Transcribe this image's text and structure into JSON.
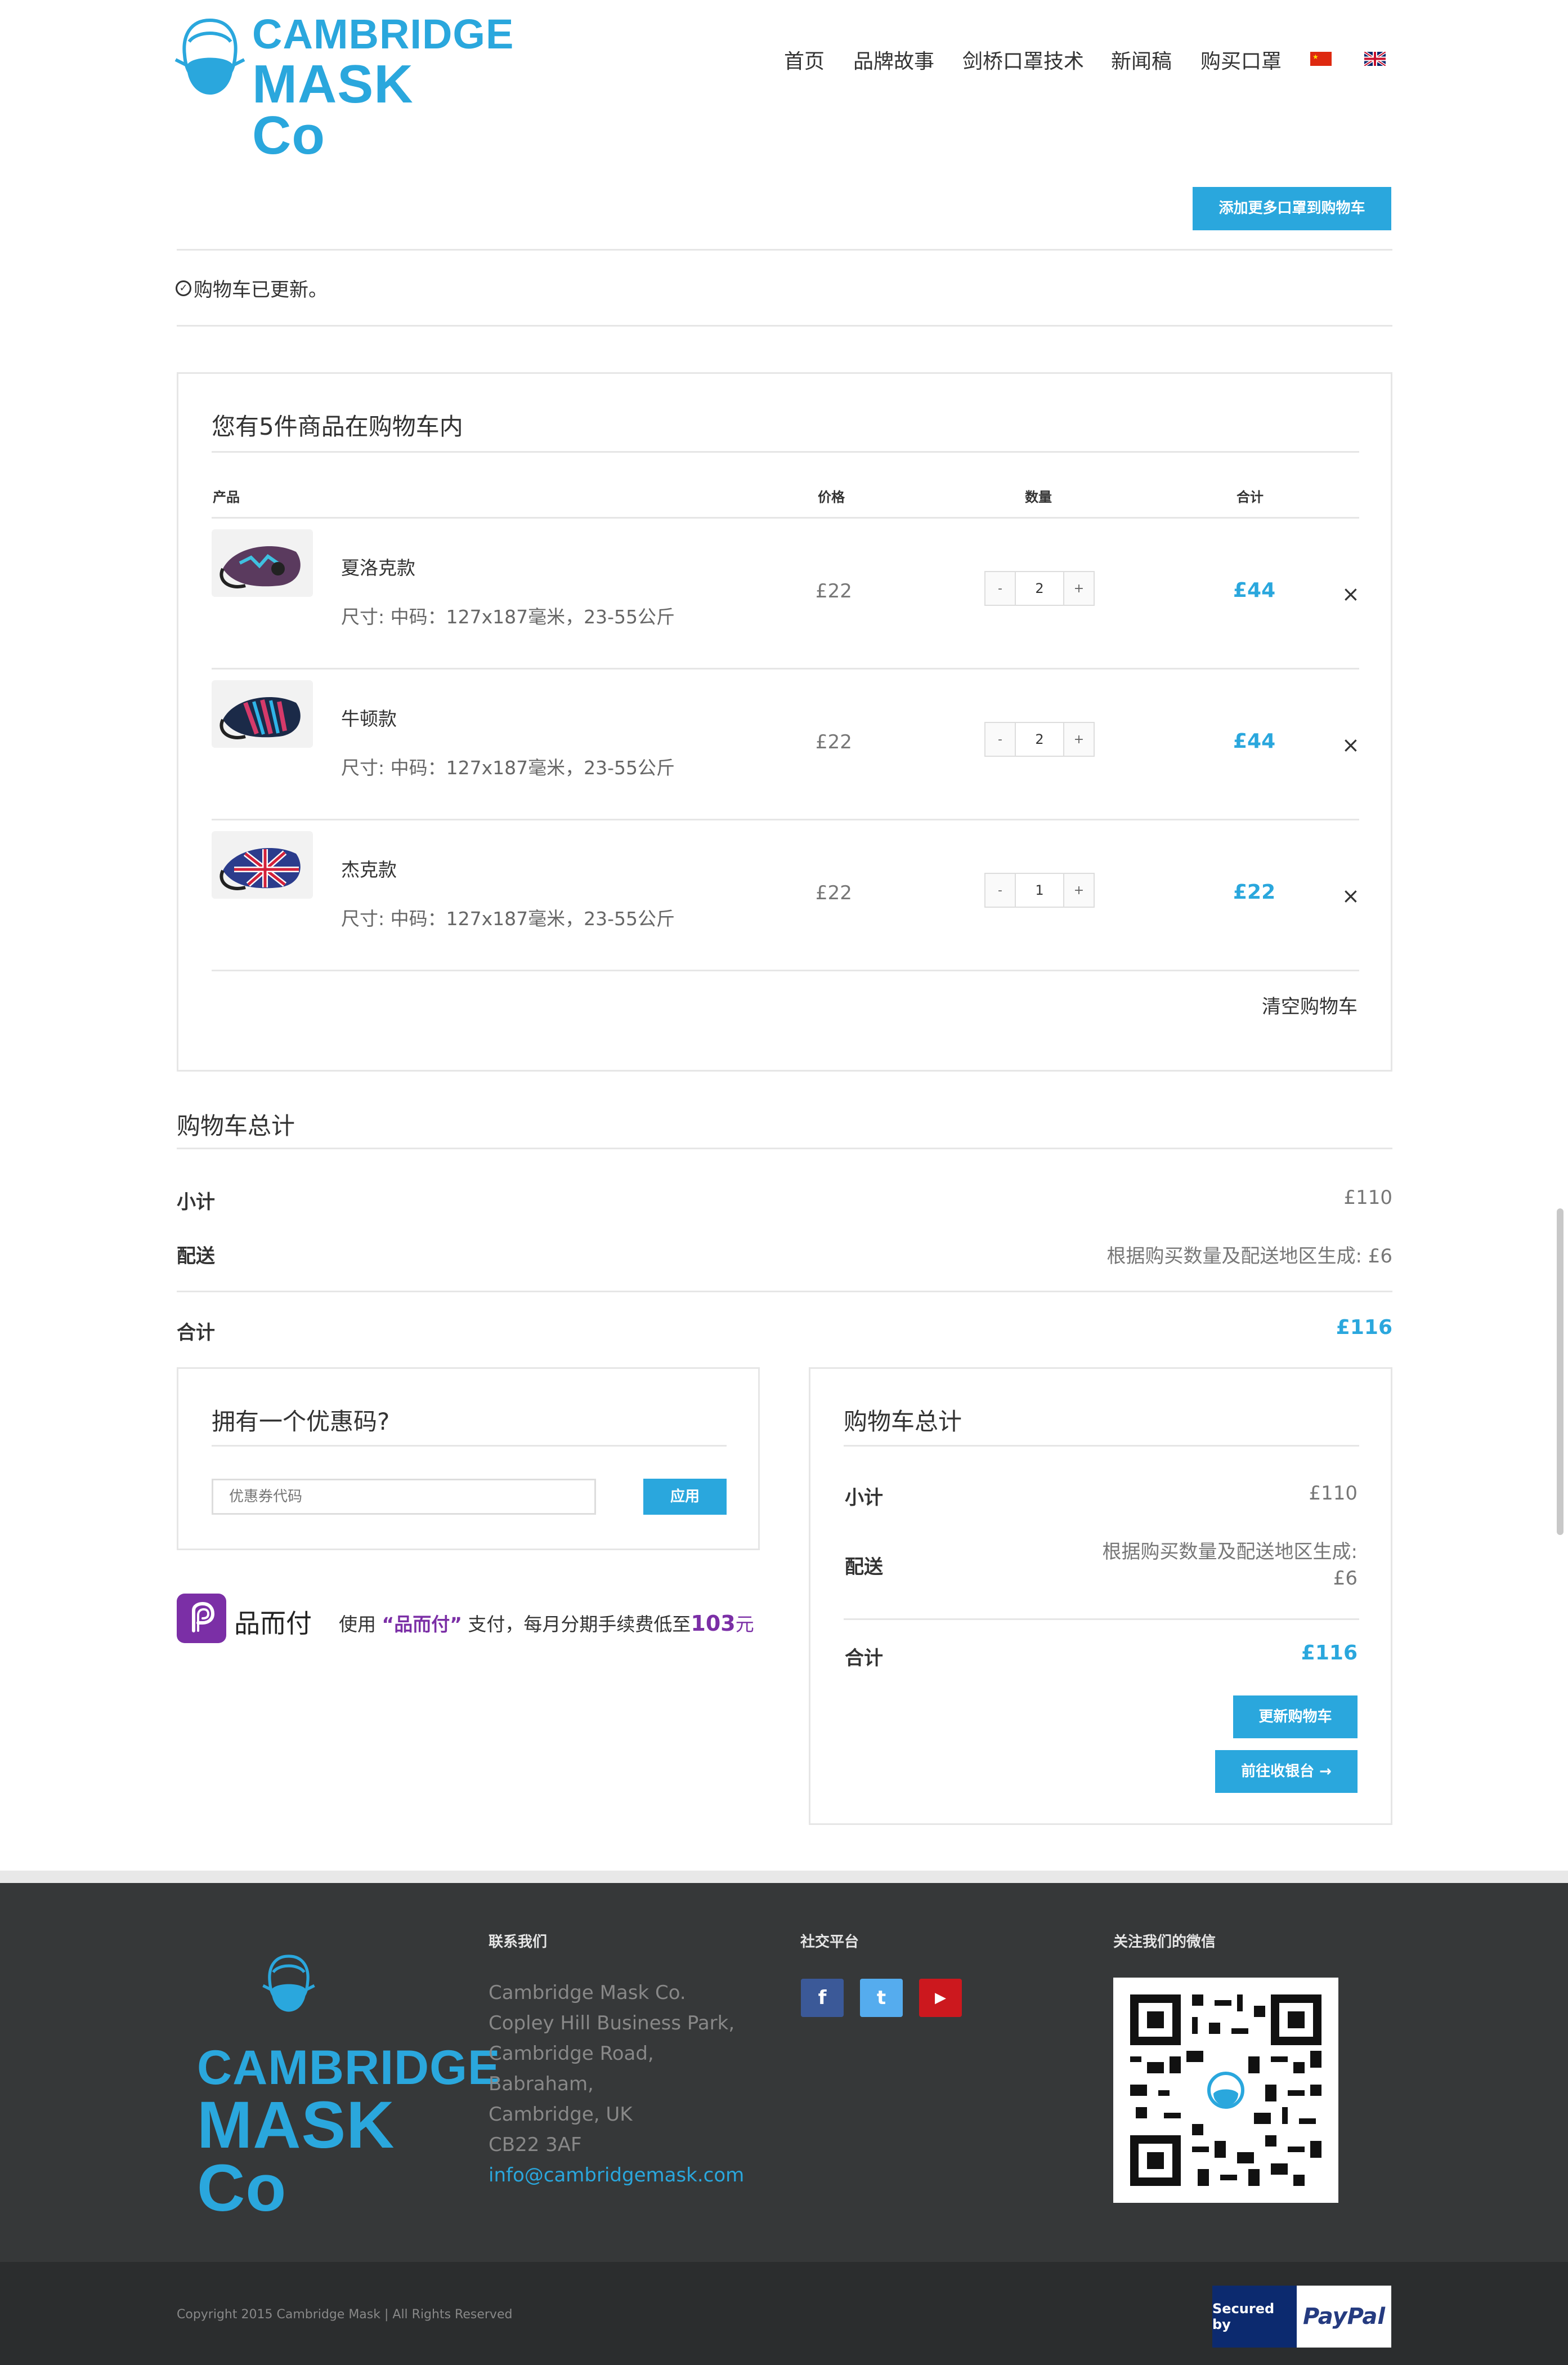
{
  "header": {
    "logo_line1": "CAMBRIDGE",
    "logo_line2": "MASK Co",
    "nav": [
      "首页",
      "品牌故事",
      "剑桥口罩技术",
      "新闻稿",
      "购买口罩"
    ],
    "lang_icons": [
      "china-flag-icon",
      "uk-flag-icon"
    ]
  },
  "cart_actions": {
    "add_more_button": "添加更多口罩到购物车",
    "updated_notice": "购物车已更新。"
  },
  "cart": {
    "heading": "您有5件商品在购物车内",
    "columns": [
      "产品",
      "价格",
      "数量",
      "合计"
    ],
    "items": [
      {
        "name": "夏洛克款",
        "meta": "尺寸: 中码：127x187毫米，23-55公斤",
        "price": "£22",
        "qty": "2",
        "total": "£44"
      },
      {
        "name": "牛顿款",
        "meta": "尺寸: 中码：127x187毫米，23-55公斤",
        "price": "£22",
        "qty": "2",
        "total": "£44"
      },
      {
        "name": "杰克款",
        "meta": "尺寸: 中码：127x187毫米，23-55公斤",
        "price": "£22",
        "qty": "1",
        "total": "£22"
      }
    ],
    "qty_minus": "-",
    "qty_plus": "+",
    "remove_symbol": "×",
    "empty_cart": "清空购物车"
  },
  "totals_top": {
    "heading": "购物车总计",
    "subtotal_label": "小计",
    "subtotal_value": "£110",
    "shipping_label": "配送",
    "shipping_value": "根据购买数量及配送地区生成: £6",
    "total_label": "合计",
    "total_value": "£116"
  },
  "coupon": {
    "heading": "拥有一个优惠码?",
    "placeholder": "优惠券代码",
    "apply_button": "应用"
  },
  "pinerfu": {
    "brand": "品而付",
    "text_prefix": "使用",
    "text_brand": "“品而付”",
    "text_middle": "支付，每月分期手续费低至",
    "amount": "103",
    "unit": "元"
  },
  "totals_box": {
    "heading": "购物车总计",
    "subtotal_label": "小计",
    "subtotal_value": "£110",
    "shipping_label": "配送",
    "shipping_line1": "根据购买数量及配送地区生成:",
    "shipping_line2": "£6",
    "total_label": "合计",
    "total_value": "£116",
    "update_button": "更新购物车",
    "checkout_button": "前往收银台 →"
  },
  "footer": {
    "logo_line1": "CAMBRIDGE",
    "logo_line2": "MASK Co",
    "contact_heading": "联系我们",
    "address": [
      "Cambridge Mask Co.",
      "Copley Hill Business Park,",
      "Cambridge Road,",
      "Babraham,",
      "Cambridge, UK",
      "CB22 3AF"
    ],
    "email": "info@cambridgemask.com",
    "social_heading": "社交平台",
    "social": [
      "f",
      "t",
      "▶"
    ],
    "wechat_heading": "关注我们的微信",
    "copyright": "Copyright 2015 Cambridge Mask | All Rights Reserved",
    "paypal_secured": "Secured by",
    "paypal_brand": "PayPal"
  },
  "colors": {
    "accent": "#2aa7dd",
    "pinerfu_purple": "#7b2fa6",
    "youtube_red": "#cc181e",
    "facebook_blue": "#3b5998",
    "twitter_blue": "#55acee"
  }
}
